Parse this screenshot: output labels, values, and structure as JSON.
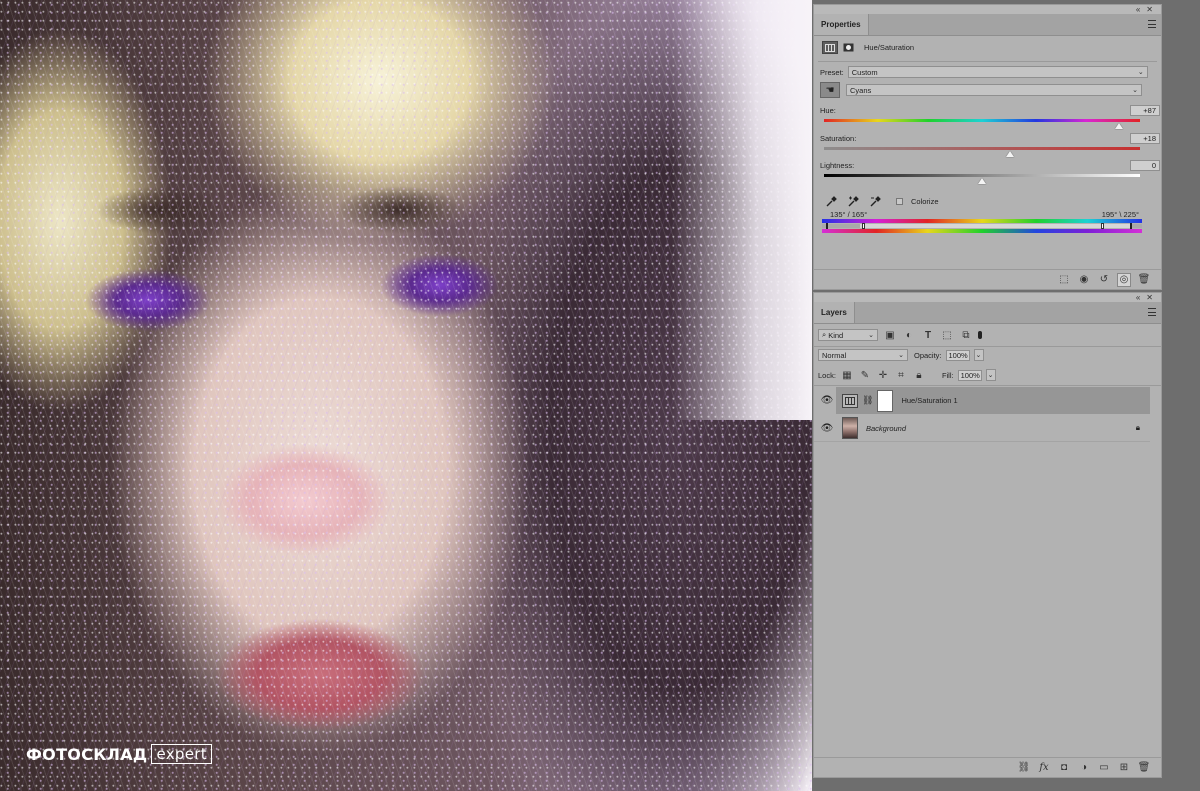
{
  "watermark": {
    "brand": "ФОТОСКЛАД",
    "sub": "expert"
  },
  "properties": {
    "tab": "Properties",
    "adjustment_title": "Hue/Saturation",
    "preset_label": "Preset:",
    "preset_value": "Custom",
    "channel_value": "Cyans",
    "hue_label": "Hue:",
    "hue_value": "+87",
    "saturation_label": "Saturation:",
    "saturation_value": "+18",
    "lightness_label": "Lightness:",
    "lightness_value": "0",
    "colorize_label": "Colorize",
    "range_left": "135° / 165°",
    "range_right": "195° \\ 225°",
    "hue_fraction": 0.935,
    "saturation_fraction": 0.59,
    "lightness_fraction": 0.5
  },
  "layers": {
    "tab": "Layers",
    "filter_kind": "Kind",
    "blend_mode": "Normal",
    "opacity_label": "Opacity:",
    "opacity_value": "100%",
    "lock_label": "Lock:",
    "fill_label": "Fill:",
    "fill_value": "100%",
    "items": [
      {
        "name": "Hue/Saturation 1"
      },
      {
        "name": "Background"
      }
    ]
  },
  "colors": {
    "panel_bg": "#b2b2b2",
    "selected_layer": "#969696",
    "workspace": "#6e6e6e"
  }
}
